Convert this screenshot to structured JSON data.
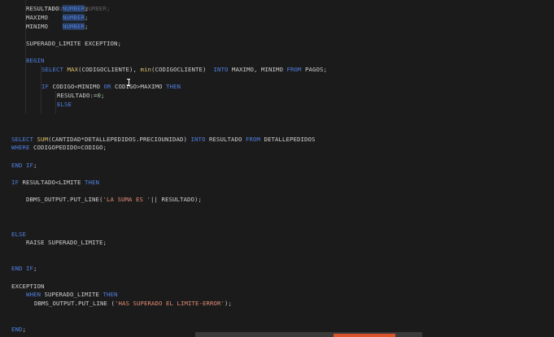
{
  "editor": {
    "lines": [
      {
        "id": "top-partial",
        "text": "RESULTADO NUMBER;"
      },
      {
        "id": "l-resultado",
        "var": "RESULTADO",
        "type": "NUMBER"
      },
      {
        "id": "l-maximo",
        "var": "MAXIMO",
        "type": "NUMBER"
      },
      {
        "id": "l-minimo",
        "var": "MINIMO",
        "type": "NUMBER"
      },
      {
        "id": "l-superado",
        "text": "SUPERADO_LIMITE EXCEPTION;"
      },
      {
        "id": "l-begin",
        "kw": "BEGIN"
      },
      {
        "id": "l-select-max",
        "kw1": "SELECT",
        "fn1": "MAX",
        "p1": "(CODIGOCLIENTE), ",
        "fn2": "min",
        "p2": "(CODIGOCLIENTE)  ",
        "kw2": "INTO",
        "p3": " MAXIMO, MINIMO ",
        "kw3": "FROM",
        "p4": " PAGOS;"
      },
      {
        "id": "l-if-codigo",
        "kw1": "IF",
        "p1": " CODIGO<MINIMO ",
        "kw2": "OR",
        "p2": " CODIGO>MAXIMO ",
        "kw3": "THEN"
      },
      {
        "id": "l-resultado-0",
        "p1": "RESULTADO:=",
        "num": "0",
        "p2": ";"
      },
      {
        "id": "l-else-inner",
        "kw": "ELSE"
      },
      {
        "id": "l-select-sum",
        "kw1": "SELECT",
        "fn1": "SUM",
        "p1": "(CANTIDAD*DETALLEPEDIDOS.PRECIOUNIDAD) ",
        "kw2": "INTO",
        "p2": " RESULTADO ",
        "kw3": "FROM",
        "p3": " DETALLEPEDIDOS"
      },
      {
        "id": "l-where",
        "kw": "WHERE",
        "p": " CODIGOPEDIDO=CODIGO;"
      },
      {
        "id": "l-endif-1",
        "kw": "END IF",
        "p": ";"
      },
      {
        "id": "l-if-limite",
        "kw1": "IF",
        "p1": " RESULTADO<LIMITE ",
        "kw2": "THEN"
      },
      {
        "id": "l-dbms-1",
        "p1": "DBMS_OUTPUT.PUT_LINE(",
        "str": "'LA SUMA ES '",
        "p2": "|| RESULTADO);"
      },
      {
        "id": "l-else-outer",
        "kw": "ELSE"
      },
      {
        "id": "l-raise",
        "p": "RAISE SUPERADO_LIMITE;"
      },
      {
        "id": "l-endif-2",
        "kw": "END IF",
        "p": ";"
      },
      {
        "id": "l-exception",
        "p": "EXCEPTION"
      },
      {
        "id": "l-when",
        "kw1": "WHEN",
        "p": " SUPERADO_LIMITE ",
        "kw2": "THEN"
      },
      {
        "id": "l-dbms-2",
        "p1": "DBMS_OUTPUT.PUT_LINE (",
        "str": "'HAS SUPERADO EL LIMITE-ERROR'",
        "p2": ");"
      },
      {
        "id": "l-end",
        "kw": "END",
        "p": ";"
      }
    ]
  },
  "colors": {
    "background": "#1b1b1b",
    "keyword": "#4f7fe0",
    "function": "#e0c070",
    "string": "#e08a72",
    "number": "#9bd39b",
    "text": "#cfcfcf",
    "accent": "#d9532b"
  }
}
